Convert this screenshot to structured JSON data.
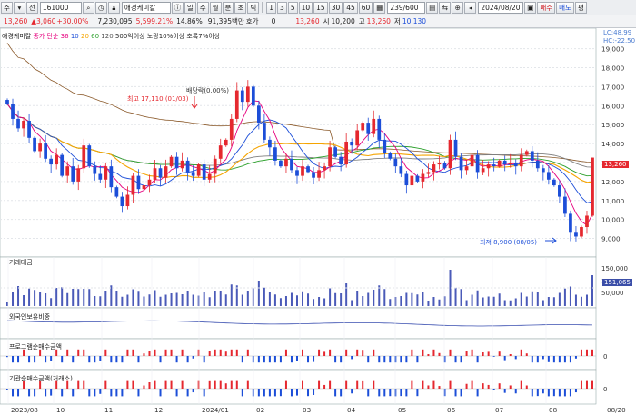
{
  "toolbar": {
    "market": "주",
    "market2": "전",
    "code": "161000",
    "name": "애경케미칼",
    "period_buttons": [
      "일",
      "주",
      "월",
      "분",
      "초",
      "틱"
    ],
    "interval_buttons": [
      "1",
      "3",
      "5",
      "10",
      "15",
      "30",
      "45",
      "60"
    ],
    "count": "239/600",
    "date": "2024/08/20",
    "buy": "매수",
    "sell": "매도",
    "extra": "평"
  },
  "quote": {
    "price": "13,260",
    "change": "3,060",
    "change_pct": "+30.00%",
    "volume": "7,230,095",
    "vol_ratio": "5,599.21%",
    "turnover": "14.86%",
    "value": "91,395백만",
    "bid_label": "호가",
    "bid": "0",
    "close": "13,260",
    "open_label": "시",
    "open": "10,200",
    "high_label": "고",
    "high": "13,260",
    "low_label": "저",
    "low": "10,130"
  },
  "legend": {
    "name": "애경케미칼",
    "ma_label": "종가 단순",
    "ma": [
      "36",
      "10",
      "20",
      "60",
      "120"
    ],
    "extra": "500억이상 노랑10%이상 초록7%이상"
  },
  "side": {
    "lc": "LC:48.99",
    "hc": "HC:-22.50",
    "price_tag": "13,260",
    "vol_tag1": "151,065",
    "vol_tag2": "150,000",
    "vol_tag3": "50,000"
  },
  "annot": {
    "high": "최고 17,110 (01/03)",
    "dividend": "배당락(0.00%)",
    "low": "최저 8,900 (08/05)"
  },
  "panels": {
    "volume": "거래대금",
    "foreign": "외국인보유비중",
    "program": "프로그램순매수금액",
    "inst": "기관순매수금액(거래소)"
  },
  "price_axis": [
    "19,000",
    "18,000",
    "17,000",
    "16,000",
    "15,000",
    "14,000",
    "13,000",
    "12,000",
    "11,000",
    "10,000",
    "9,000"
  ],
  "vol_axis": [
    "150,000",
    "100,000",
    "50,000"
  ],
  "x_labels": [
    "2023/08",
    "10",
    "11",
    "12",
    "2024/01",
    "02",
    "03",
    "04",
    "05",
    "06",
    "07",
    "08",
    "08/20"
  ],
  "colors": {
    "up": "#e5282f",
    "down": "#1c4ed8",
    "ma5": "#e6007e",
    "ma10": "#1c4ed8",
    "ma20": "#f5a400",
    "ma60": "#2ca02c",
    "ma120": "#7f7f7f",
    "ma_ext": "#8b5a2b"
  },
  "chart_data": {
    "type": "candlestick",
    "title": "애경케미칼",
    "close": [
      16100,
      15300,
      14800,
      15200,
      14300,
      13600,
      14000,
      13200,
      12900,
      13400,
      12300,
      12800,
      12000,
      12700,
      13900,
      12800,
      12400,
      12100,
      12800,
      11700,
      11200,
      10700,
      11300,
      12300,
      11600,
      11800,
      12100,
      12700,
      12200,
      12800,
      13300,
      12700,
      13100,
      12500,
      12300,
      12900,
      12100,
      12400,
      13200,
      13900,
      14200,
      15300,
      16800,
      16200,
      17000,
      16000,
      15100,
      14200,
      13800,
      13100,
      12800,
      13200,
      12600,
      12300,
      12800,
      12500,
      12200,
      12600,
      12800,
      13800,
      13300,
      12900,
      14100,
      13900,
      14700,
      15100,
      14500,
      15300,
      14200,
      13500,
      13200,
      12800,
      12400,
      11800,
      12300,
      12000,
      12400,
      12500,
      12900,
      13000,
      12700,
      14200,
      13300,
      12600,
      12800,
      13400,
      12500,
      12700,
      12900,
      12800,
      13100,
      12900,
      13000,
      12800,
      13400,
      13600,
      13100,
      12700,
      12500,
      12100,
      11800,
      11200,
      10300,
      9300,
      9100,
      9600,
      10200,
      13260
    ]
  }
}
